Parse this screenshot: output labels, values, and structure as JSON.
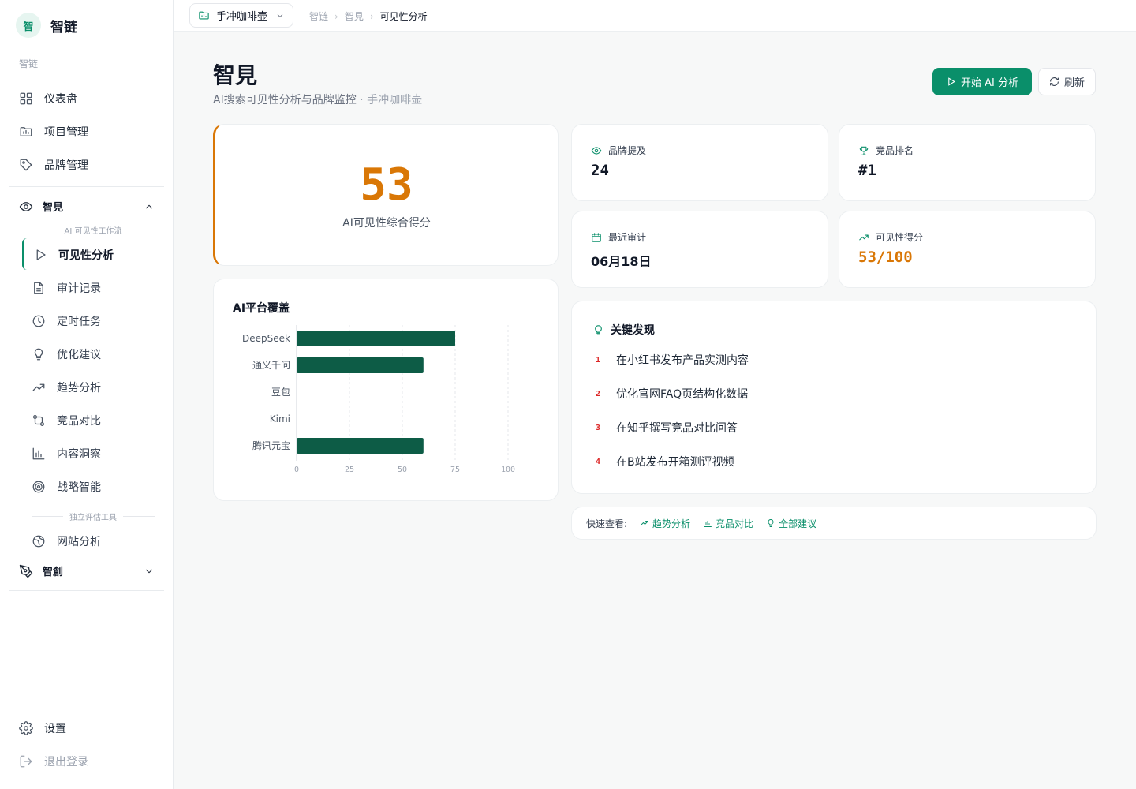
{
  "app": {
    "logo_char": "智",
    "name": "智链"
  },
  "sidebar": {
    "section_label": "智链",
    "items": [
      {
        "label": "仪表盘",
        "icon": "grid-icon"
      },
      {
        "label": "项目管理",
        "icon": "folder-chart-icon"
      },
      {
        "label": "品牌管理",
        "icon": "tag-icon"
      }
    ],
    "group": {
      "label": "智見",
      "icon": "eye-icon",
      "sub_label_workflow": "AI 可见性工作流",
      "sub_items": [
        {
          "label": "可见性分析",
          "icon": "play-icon",
          "active": true
        },
        {
          "label": "审计记录",
          "icon": "file-text-icon"
        },
        {
          "label": "定时任务",
          "icon": "clock-icon"
        },
        {
          "label": "优化建议",
          "icon": "lightbulb-icon"
        },
        {
          "label": "趋势分析",
          "icon": "trending-up-icon"
        },
        {
          "label": "竞品对比",
          "icon": "compare-icon"
        },
        {
          "label": "内容洞察",
          "icon": "bar-chart-icon"
        },
        {
          "label": "战略智能",
          "icon": "target-icon"
        }
      ],
      "sub_label_tools": "独立评估工具",
      "tool_items": [
        {
          "label": "网站分析",
          "icon": "globe-icon"
        }
      ]
    },
    "group2": {
      "label": "智創",
      "icon": "pen-tool-icon"
    },
    "bottom": [
      {
        "label": "设置",
        "icon": "gear-icon"
      },
      {
        "label": "退出登录",
        "icon": "logout-icon"
      }
    ]
  },
  "topbar": {
    "project": "手冲咖啡壶",
    "breadcrumbs": [
      "智链",
      "智見",
      "可见性分析"
    ]
  },
  "header": {
    "title": "智見",
    "subtitle": "AI搜索可见性分析与品牌监控",
    "subtitle_project": "· 手冲咖啡壶",
    "primary_button": "开始 AI 分析",
    "secondary_button": "刷新"
  },
  "score": {
    "value": "53",
    "label": "AI可见性综合得分"
  },
  "stats": {
    "mentions": {
      "label": "品牌提及",
      "value": "24"
    },
    "rank": {
      "label": "竞品排名",
      "value": "#1"
    },
    "last_audit": {
      "label": "最近审计",
      "value": "06月18日"
    },
    "visibility": {
      "label": "可见性得分",
      "value": "53/100"
    }
  },
  "chart_data": {
    "type": "bar",
    "orientation": "horizontal",
    "title": "AI平台覆盖",
    "categories": [
      "DeepSeek",
      "通义千问",
      "豆包",
      "Kimi",
      "腾讯元宝"
    ],
    "values": [
      75,
      60,
      0,
      0,
      60
    ],
    "xlim": [
      0,
      100
    ],
    "xticks": [
      0,
      25,
      50,
      75,
      100
    ],
    "grid": true,
    "bar_color": "#0d5c46"
  },
  "findings": {
    "title": "关键发现",
    "items": [
      {
        "num": "1",
        "text": "在小红书发布产品实测内容"
      },
      {
        "num": "2",
        "text": "优化官网FAQ页结构化数据"
      },
      {
        "num": "3",
        "text": "在知乎撰写竞品对比问答"
      },
      {
        "num": "4",
        "text": "在B站发布开箱测评视频"
      }
    ]
  },
  "quick": {
    "label": "快速查看:",
    "links": [
      {
        "label": "趋势分析",
        "icon": "trending-up-icon"
      },
      {
        "label": "竞品对比",
        "icon": "bar-chart-icon"
      },
      {
        "label": "全部建议",
        "icon": "lightbulb-icon"
      }
    ]
  },
  "colors": {
    "accent": "#0a8f6a",
    "score": "#d97706",
    "bar": "#0d5c46",
    "finding_num": "#dc2626"
  }
}
